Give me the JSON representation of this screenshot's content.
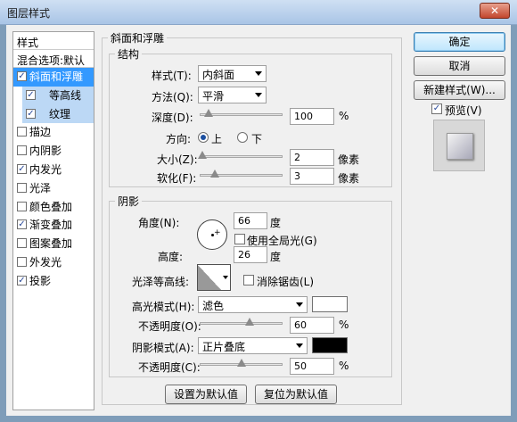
{
  "window": {
    "title": "图层样式",
    "close": "✕"
  },
  "styles": {
    "header": "样式",
    "blend": "混合选项:默认",
    "items": [
      {
        "label": "斜面和浮雕",
        "checked": true,
        "state": "selected"
      },
      {
        "label": "等高线",
        "checked": true,
        "state": "sub"
      },
      {
        "label": "纹理",
        "checked": true,
        "state": "sub"
      },
      {
        "label": "描边",
        "checked": false,
        "state": ""
      },
      {
        "label": "内阴影",
        "checked": false,
        "state": ""
      },
      {
        "label": "内发光",
        "checked": true,
        "state": ""
      },
      {
        "label": "光泽",
        "checked": false,
        "state": ""
      },
      {
        "label": "颜色叠加",
        "checked": false,
        "state": ""
      },
      {
        "label": "渐变叠加",
        "checked": true,
        "state": ""
      },
      {
        "label": "图案叠加",
        "checked": false,
        "state": ""
      },
      {
        "label": "外发光",
        "checked": false,
        "state": ""
      },
      {
        "label": "投影",
        "checked": true,
        "state": ""
      }
    ]
  },
  "bevel": {
    "group_title": "斜面和浮雕",
    "structure": {
      "title": "结构",
      "style_label": "样式(T):",
      "style_value": "内斜面",
      "technique_label": "方法(Q):",
      "technique_value": "平滑",
      "depth_label": "深度(D):",
      "depth_value": "100",
      "depth_level": 0.1,
      "percent": "%",
      "direction_label": "方向:",
      "dir_up": "上",
      "dir_down": "下",
      "direction": "up",
      "size_label": "大小(Z):",
      "size_value": "2",
      "size_level": 0.02,
      "soften_label": "软化(F):",
      "soften_value": "3",
      "soften_level": 0.18,
      "px_unit": "像素"
    },
    "shading": {
      "title": "阴影",
      "angle_label": "角度(N):",
      "angle_value": "66",
      "degree": "度",
      "global_light_label": "使用全局光(G)",
      "global_light_checked": false,
      "altitude_label": "高度:",
      "altitude_value": "26",
      "gloss_label": "光泽等高线:",
      "antialias_label": "消除锯齿(L)",
      "antialias_checked": false,
      "highlight_mode_label": "高光模式(H):",
      "highlight_mode_value": "滤色",
      "highlight_color": "#ffffff",
      "highlight_opacity_label": "不透明度(O):",
      "highlight_opacity_value": "60",
      "highlight_opacity_level": 0.6,
      "shadow_mode_label": "阴影模式(A):",
      "shadow_mode_value": "正片叠底",
      "shadow_color": "#000000",
      "shadow_opacity_label": "不透明度(C):",
      "shadow_opacity_value": "50",
      "shadow_opacity_level": 0.5,
      "percent": "%"
    },
    "set_default": "设置为默认值",
    "reset_default": "复位为默认值"
  },
  "actions": {
    "ok": "确定",
    "cancel": "取消",
    "new_style": "新建样式(W)...",
    "preview_label": "预览(V)",
    "preview_checked": true
  }
}
